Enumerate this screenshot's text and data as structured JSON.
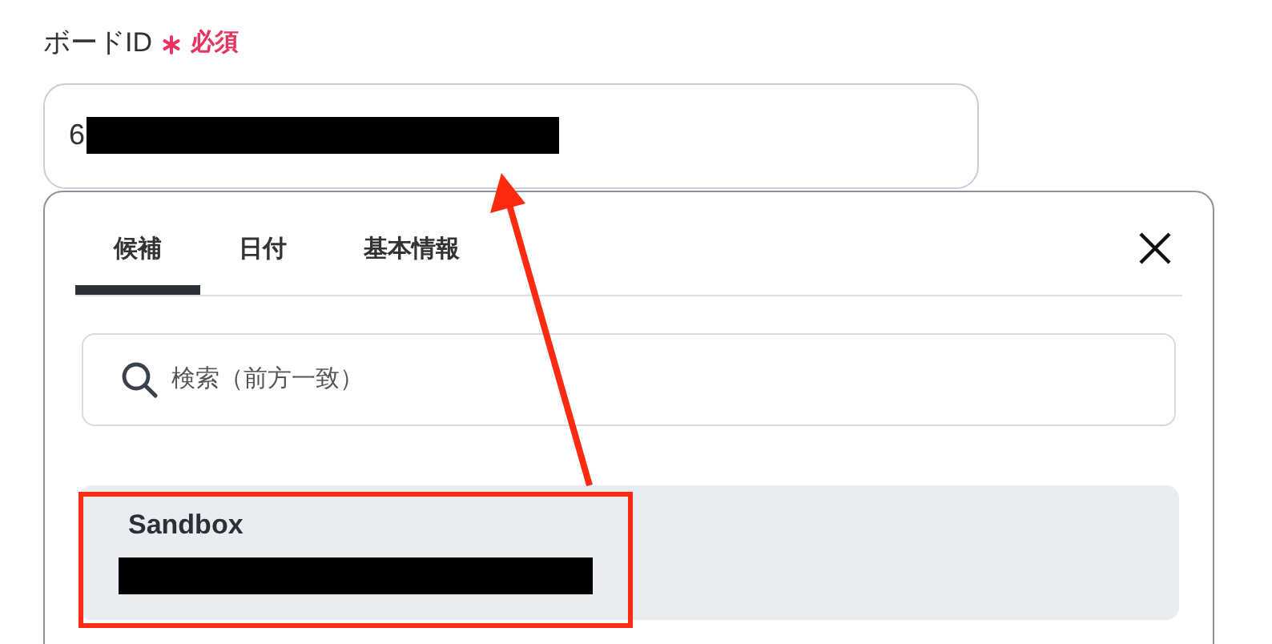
{
  "field": {
    "label": "ボードID",
    "required": "必須",
    "value": "6"
  },
  "dropdown": {
    "tabs": [
      {
        "label": "候補",
        "selected": true
      },
      {
        "label": "日付",
        "selected": false
      },
      {
        "label": "基本情報",
        "selected": false
      }
    ],
    "search": {
      "placeholder": "検索（前方一致）"
    },
    "items": [
      {
        "title": "Sandbox",
        "selected": true
      }
    ]
  }
}
